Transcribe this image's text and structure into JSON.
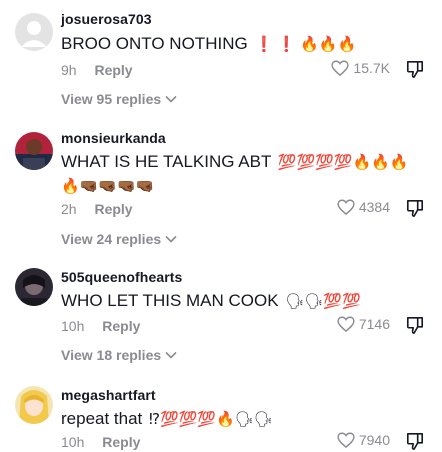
{
  "comments": [
    {
      "username": "josuerosa703",
      "text": "BROO ONTO NOTHING",
      "emoji": "❗ ❗ 🔥🔥🔥",
      "time": "9h",
      "reply_label": "Reply",
      "likes": "15.7K",
      "view_replies": "View 95 replies",
      "avatar_icon": "default-avatar-icon"
    },
    {
      "username": "monsieurkanda",
      "text": "WHAT IS HE TALKING ABT",
      "emoji": "💯💯💯💯🔥🔥🔥",
      "emoji_line2": "🔥🤜🏾🤜🏾🤜🏾🤜🏾",
      "time": "2h",
      "reply_label": "Reply",
      "likes": "4384",
      "view_replies": "View 24 replies",
      "avatar_icon": "user-photo-avatar"
    },
    {
      "username": "505queenofhearts",
      "text": "WHO LET THIS MAN COOK",
      "emoji": "🗣🗣💯💯",
      "time": "10h",
      "reply_label": "Reply",
      "likes": "7146",
      "view_replies": "View 18 replies",
      "avatar_icon": "user-photo-avatar"
    },
    {
      "username": "megashartfart",
      "text": "repeat that",
      "emoji": "⁉💯💯💯🔥🗣🗣",
      "time": "10h",
      "reply_label": "Reply",
      "likes": "7940",
      "avatar_icon": "anime-avatar"
    }
  ],
  "colors": {
    "text": "#161823",
    "muted": "#8a8b91",
    "fire": "#ff6a00",
    "hundred": "#e0245e"
  }
}
